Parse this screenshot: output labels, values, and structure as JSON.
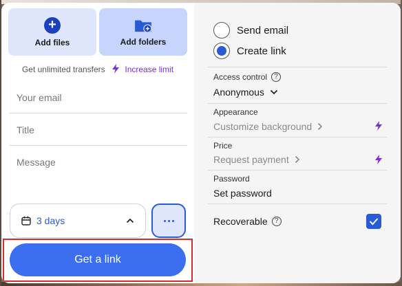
{
  "add": {
    "files_label": "Add files",
    "folders_label": "Add folders"
  },
  "transfer": {
    "text": "Get unlimited transfers",
    "limit_link": "Increase limit"
  },
  "form": {
    "email_placeholder": "Your email",
    "title_placeholder": "Title",
    "message_placeholder": "Message"
  },
  "expiry": {
    "value": "3 days"
  },
  "actions": {
    "get_link": "Get a link"
  },
  "mode": {
    "send_email": "Send email",
    "create_link": "Create link",
    "selected": "Create link"
  },
  "settings": {
    "access_label": "Access control",
    "access_value": "Anonymous",
    "appearance_label": "Appearance",
    "appearance_value": "Customize background",
    "price_label": "Price",
    "price_value": "Request payment",
    "password_label": "Password",
    "password_value": "Set password",
    "recoverable_label": "Recoverable",
    "recoverable_checked": true
  },
  "colors": {
    "accent": "#2a5bd7",
    "button": "#3b6ff0",
    "premium": "#7a2ed6",
    "highlight": "#d82a2a"
  }
}
